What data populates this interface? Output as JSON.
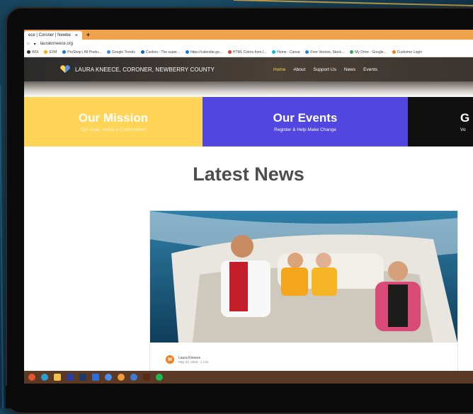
{
  "browser": {
    "tab_title": "ece | Coroner | Newbe",
    "tab_close": "×",
    "new_tab": "+",
    "url": "lauraknneece.org",
    "bookmarks": [
      {
        "label": "WIX",
        "color": "#333333"
      },
      {
        "label": "EVM",
        "color": "#f2b300"
      },
      {
        "label": "ProShop | All Produ...",
        "color": "#1a73e8"
      },
      {
        "label": "Google Trends",
        "color": "#4285f4"
      },
      {
        "label": "Coolors - The super...",
        "color": "#0a66c2"
      },
      {
        "label": "https://calendar.go...",
        "color": "#1a73e8"
      },
      {
        "label": "HTML Colors from l...",
        "color": "#e53935"
      },
      {
        "label": "Home - Canva",
        "color": "#00c4cc"
      },
      {
        "label": "Free Vectors, Stock...",
        "color": "#1e88e5"
      },
      {
        "label": "My Drive - Google...",
        "color": "#34a853"
      },
      {
        "label": "Customer Login",
        "color": "#f57c00"
      }
    ]
  },
  "site": {
    "title": "LAURA KNEECE, CORONER, NEWBERRY COUNTY",
    "nav": [
      "Home",
      "About",
      "Support Us",
      "News",
      "Events"
    ],
    "active_nav": "Home",
    "accent": "#ffd84a"
  },
  "tiles": [
    {
      "title": "Our Mission",
      "subtitle": "Our Goal, Vision & Commitment",
      "color": "#ffd457"
    },
    {
      "title": "Our Events",
      "subtitle": "Register & Help Make Change",
      "color": "#5147e0"
    },
    {
      "title": "G",
      "subtitle": "Vo",
      "color": "#111111"
    }
  ],
  "main": {
    "heading": "Latest News",
    "post": {
      "avatar_initial": "M",
      "author": "Laura Kneece",
      "meta": "May 23, 2018 · 1 min"
    }
  },
  "taskbar": {
    "icons": [
      "start-icon",
      "edge-icon",
      "file-explorer-icon",
      "creative-cloud-icon",
      "lightroom-icon",
      "photos-icon",
      "chrome-icon",
      "firefox-icon",
      "settings-icon",
      "illustrator-icon",
      "spotify-icon"
    ]
  }
}
